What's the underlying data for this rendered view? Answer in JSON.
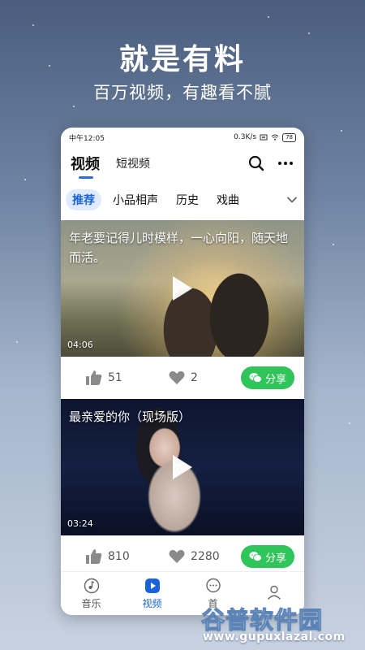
{
  "promo": {
    "headline": "就是有料",
    "subline": "百万视频，有趣看不腻"
  },
  "statusbar": {
    "time": "中午12:05",
    "network": "0.3K/s",
    "battery": "78"
  },
  "header": {
    "main_tab": "视频",
    "secondary_tab": "短视频",
    "icons": [
      "search-icon",
      "more-icon"
    ]
  },
  "categories": {
    "items": [
      {
        "label": "推荐",
        "active": true
      },
      {
        "label": "小品相声",
        "active": false
      },
      {
        "label": "历史",
        "active": false
      },
      {
        "label": "戏曲",
        "active": false
      }
    ]
  },
  "feed": [
    {
      "title": "年老要记得儿时模样，一心向阳，随天地而活。",
      "duration": "04:06",
      "likes": "51",
      "favorites": "2",
      "share_label": "分享"
    },
    {
      "title": "最亲爱的你（现场版）",
      "duration": "03:24",
      "likes": "810",
      "favorites": "2280",
      "share_label": "分享"
    }
  ],
  "bottomnav": {
    "items": [
      {
        "label": "音乐",
        "icon": "music-icon",
        "active": false
      },
      {
        "label": "视频",
        "icon": "video-icon",
        "active": true
      },
      {
        "label": "首",
        "icon": "chat-icon",
        "active": false
      },
      {
        "label": "",
        "icon": "profile-icon",
        "active": false
      }
    ]
  },
  "watermark": {
    "name": "谷普软件园",
    "url": "www.gupuxlazal.com"
  },
  "colors": {
    "accent": "#1b63d8",
    "share_green": "#2fc55a"
  }
}
